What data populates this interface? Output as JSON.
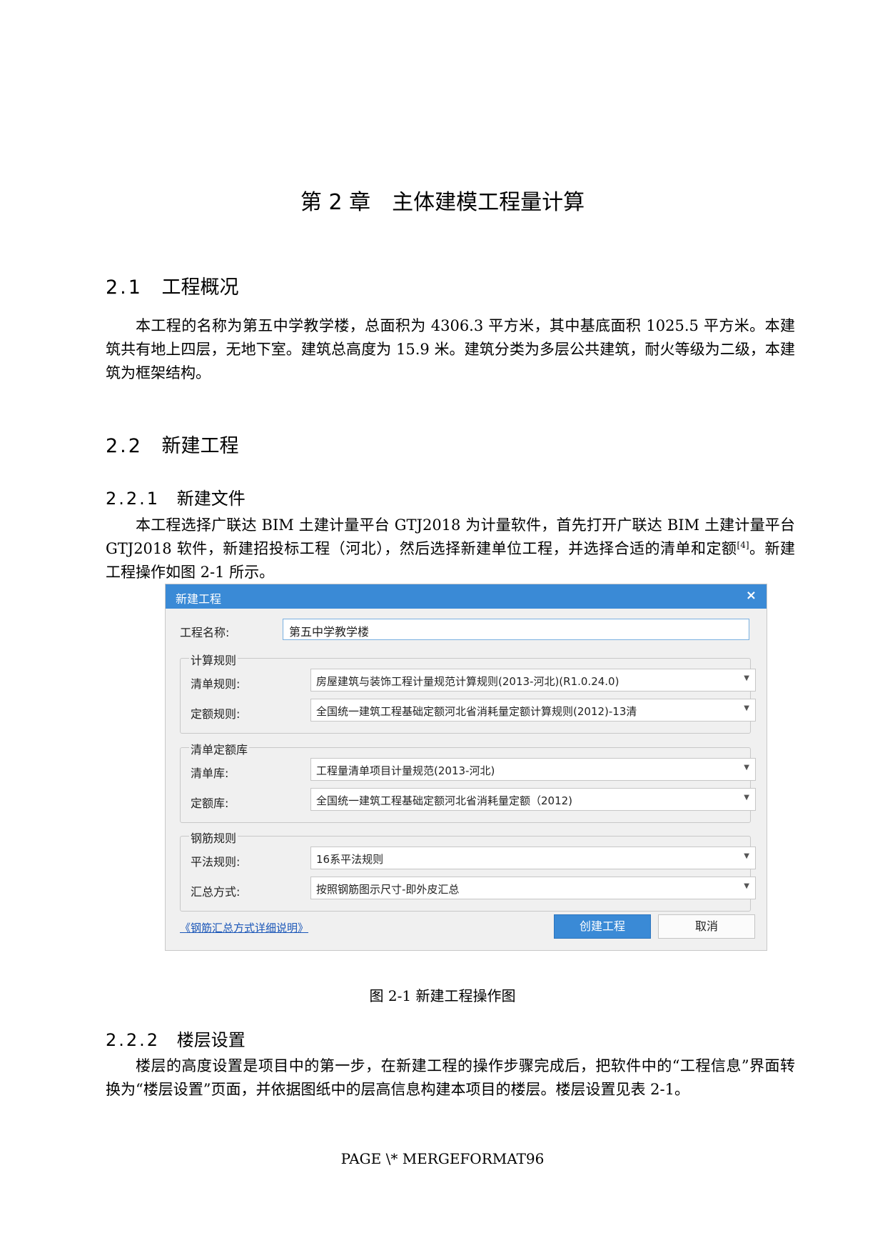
{
  "chapter": {
    "number": "第 2 章",
    "title": "主体建模工程量计算"
  },
  "sections": {
    "s21": {
      "number": "2.1",
      "title": "工程概况"
    },
    "s22": {
      "number": "2.2",
      "title": "新建工程"
    },
    "s221": {
      "number": "2.2.1",
      "title": "新建文件"
    },
    "s222": {
      "number": "2.2.2",
      "title": "楼层设置"
    }
  },
  "paragraphs": {
    "overview": "本工程的名称为第五中学教学楼，总面积为 4306.3 平方米，其中基底面积 1025.5 平方米。本建筑共有地上四层，无地下室。建筑总高度为 15.9 米。建筑分类为多层公共建筑，耐火等级为二级，本建筑为框架结构。",
    "newfile_a": "本工程选择广联达 BIM 土建计量平台 GTJ2018 为计量软件，首先打开广联达 BIM 土建计量平台 GTJ2018 软件，新建招投标工程（河北），然后选择新建单位工程，并选择合适的清单和定额",
    "newfile_ref": "[4]",
    "newfile_b": "。新建工程操作如图 2-1 所示。",
    "floors": "楼层的高度设置是项目中的第一步，在新建工程的操作步骤完成后，把软件中的“工程信息”界面转换为“楼层设置”页面，并依据图纸中的层高信息构建本项目的楼层。楼层设置见表 2-1。"
  },
  "dialog": {
    "title": "新建工程",
    "close": "×",
    "name_label": "工程名称:",
    "name_value": "第五中学教学楼",
    "group_calc": {
      "title": "计算规则",
      "list_label": "清单规则:",
      "list_value": "房屋建筑与装饰工程计量规范计算规则(2013-河北)(R1.0.24.0)",
      "quota_label": "定额规则:",
      "quota_value": "全国统一建筑工程基础定额河北省消耗量定额计算规则(2012)-13清"
    },
    "group_lib": {
      "title": "清单定额库",
      "list_label": "清单库:",
      "list_value": "工程量清单项目计量规范(2013-河北)",
      "quota_label": "定额库:",
      "quota_value": "全国统一建筑工程基础定额河北省消耗量定额（2012)"
    },
    "group_rebar": {
      "title": "钢筋规则",
      "rule_label": "平法规则:",
      "rule_value": "16系平法规则",
      "sum_label": "汇总方式:",
      "sum_value": "按照钢筋图示尺寸-即外皮汇总"
    },
    "link": "《钢筋汇总方式详细说明》",
    "create_button": "创建工程",
    "cancel_button": "取消",
    "arrow": "▼"
  },
  "caption": "图 2-1 新建工程操作图",
  "footer": "PAGE \\* MERGEFORMAT96",
  "colors": {
    "titlebar": "#3a8ad6",
    "link": "#1a56b8"
  }
}
